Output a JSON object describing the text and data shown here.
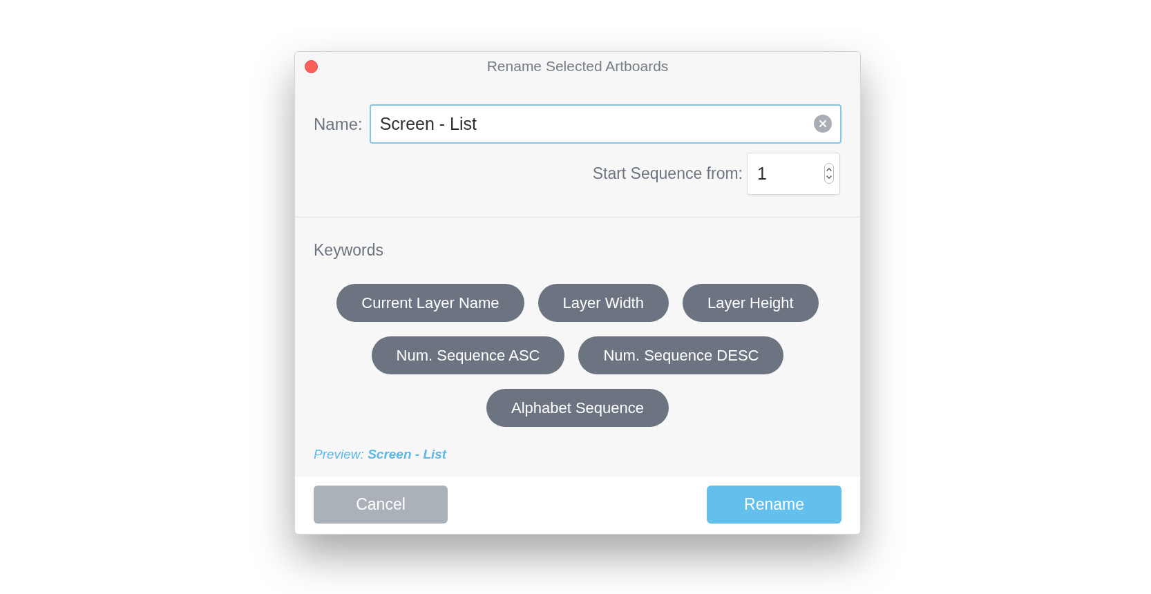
{
  "window": {
    "title": "Rename Selected Artboards"
  },
  "name": {
    "label": "Name:",
    "value": "Screen - List"
  },
  "start_sequence": {
    "label": "Start Sequence from:",
    "value": "1"
  },
  "keywords": {
    "heading": "Keywords",
    "items": [
      "Current Layer Name",
      "Layer Width",
      "Layer Height",
      "Num. Sequence ASC",
      "Num. Sequence DESC",
      "Alphabet Sequence"
    ]
  },
  "preview": "Preview: **Screen - List**",
  "buttons": [
    {
      "label": "Cancel",
      "kind": "secondary"
    },
    {
      "label": "Rename",
      "kind": "primary"
    }
  ]
}
